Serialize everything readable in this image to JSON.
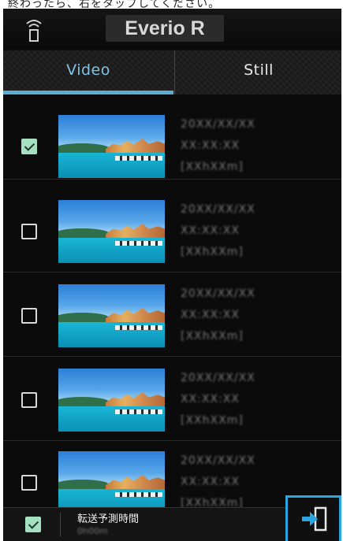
{
  "caption_text": "終わったら、右をタップしてください。",
  "header": {
    "app_title": "Everio R",
    "wifi_icon": "wifi-icon"
  },
  "tabs": [
    {
      "label": "Video",
      "selected": true
    },
    {
      "label": "Still",
      "selected": false
    }
  ],
  "colors": {
    "accent": "#5aaed6",
    "check_on": "#a6e0c3",
    "transfer_frame": "#2aa7e0"
  },
  "items": [
    {
      "date": "20XX/XX/XX",
      "time": "XX:XX:XX",
      "duration": "[XXhXXm]",
      "checked": true
    },
    {
      "date": "20XX/XX/XX",
      "time": "XX:XX:XX",
      "duration": "[XXhXXm]",
      "checked": false
    },
    {
      "date": "20XX/XX/XX",
      "time": "XX:XX:XX",
      "duration": "[XXhXXm]",
      "checked": false
    },
    {
      "date": "20XX/XX/XX",
      "time": "XX:XX:XX",
      "duration": "[XXhXXm]",
      "checked": false
    },
    {
      "date": "20XX/XX/XX",
      "time": "XX:XX:XX",
      "duration": "[XXhXXm]",
      "checked": false
    }
  ],
  "footer": {
    "select_all_checked": true,
    "eta_label": "転送予測時間",
    "eta_value": "0h00m",
    "transfer_icon": "transfer-icon"
  }
}
